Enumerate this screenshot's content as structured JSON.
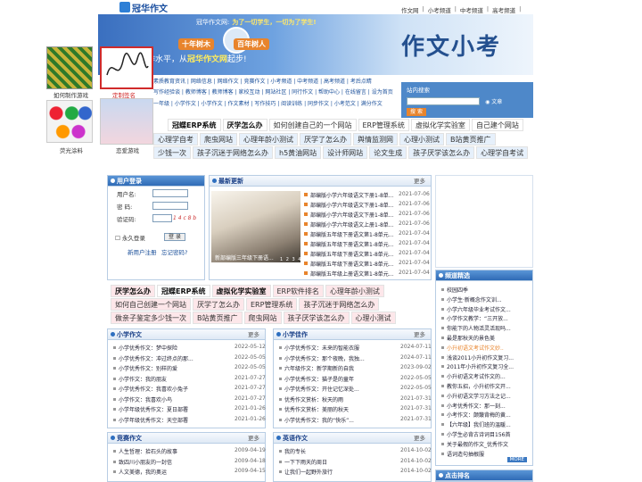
{
  "header": {
    "logo_text": "冠华作文",
    "top_links": [
      "作文网",
      "|",
      "小考频道",
      "|",
      "中考频道",
      "|",
      "高考频道",
      "|"
    ],
    "slogan_site": "冠华作文网:",
    "slogan": "为了一切学生，一切为了学生!",
    "tag1": "十年树木",
    "tag2": "百年树人",
    "sub_prefix": "作水平，从",
    "sub_brand": "冠华作文网",
    "sub_suffix": "起步!",
    "big_title": "作文小考"
  },
  "ads": [
    {
      "caption": "如何制作游戏"
    },
    {
      "caption": "定制签名"
    },
    {
      "caption": "荧光涂料"
    },
    {
      "caption": "恋爱游戏"
    }
  ],
  "nav_lines": [
    "素质教育资讯 | 网络信息 | 网络作文 | 竞赛作文 | 小考频道 | 中考频道 | 高考频道 | 考后点睛",
    "写作经验谈 | 教师博客 | 教师博客 | 家校互动 | 网站社区 | 同行作文 | 帮助中心 | 在线留言 | 设为首页",
    "一年级 | 小学作文 | 小学作文 | 作文素材 | 写作技巧 | 阅读训练 | 同步作文 | 小考范文 | 满分作文"
  ],
  "search": {
    "title": "站内搜索",
    "radio": "文章",
    "button": "搜 索"
  },
  "tag_rows": [
    [
      "冠蝶ERP系统",
      "厌学怎么办",
      "如何创建自己的一个网站",
      "ERP管理系统",
      "虚拟化学实验室",
      "自己建个网站"
    ],
    [
      "心理学自考",
      "爬虫网站",
      "心理年龄小测试",
      "厌学了怎么办",
      "舆情监测网",
      "心理小测试",
      "B站黄页推广"
    ],
    [
      "少钱一次",
      "孩子沉迷于网络怎么办",
      "h5黄油网站",
      "设计师网站",
      "论文生成",
      "孩子厌学该怎么办",
      "心理学自考试"
    ]
  ],
  "tag_rows2": [
    [
      "厌学怎么办",
      "冠蝶ERP系统",
      "虚拟化学实验室",
      "ERP软件排名",
      "心理年龄小测试"
    ],
    [
      "如何自己创建一个网站",
      "厌学了怎么办",
      "ERP管理系统",
      "孩子沉迷于网络怎么办"
    ],
    [
      "做亲子鉴定多少钱一次",
      "B站黄页推广",
      "爬虫网站",
      "孩子厌学该怎么办",
      "心理小测试"
    ]
  ],
  "login": {
    "title": "用户登录",
    "user_label": "用户名:",
    "pwd_label": "密 码:",
    "code_label": "验证码:",
    "captcha": "1 4 c 8 b",
    "remember": "永久登录",
    "login_btn": "登 录",
    "register": "新用户注册",
    "forgot": "忘记密码?"
  },
  "latest": {
    "title": "最新更新",
    "more": "更多",
    "img_caption": "新部编版三年级下册语...",
    "pager": "1 2 3 4 5",
    "items": [
      {
        "t": "部编版小学六年级语文下册1-8单...",
        "d": "2021-07-06"
      },
      {
        "t": "部编版小学六年级语文下册1-8单...",
        "d": "2021-07-06"
      },
      {
        "t": "部编版小学六年级语文下册1-8单...",
        "d": "2021-07-06"
      },
      {
        "t": "部编版小学六年级语文上册1-8单...",
        "d": "2021-07-06"
      },
      {
        "t": "部编版五年级下册语文第1-8单元...",
        "d": "2021-07-04"
      },
      {
        "t": "部编版五年级下册语文第1-8单元...",
        "d": "2021-07-04"
      },
      {
        "t": "部编版五年级下册语文第1-8单元...",
        "d": "2021-07-04"
      },
      {
        "t": "部编版五年级下册语文第1-8单元...",
        "d": "2021-07-04"
      },
      {
        "t": "部编版五年级上册语文第1-8单元...",
        "d": "2021-07-04"
      }
    ]
  },
  "pindao": {
    "title": "频道精选",
    "items": [
      "校园四季",
      "小学生·新概念作文训...",
      "小学六年级毕业考试作文...",
      "小学作文教学：“三开放...",
      "你能下的人物活灵活现吗...",
      "最是那秋天的景色美",
      "小升初语文考试作文妙..",
      "浅谈2011小升初作文复习...",
      "2011年小升初作文复习全...",
      "小升初语文考试作文的...",
      "教你五招，小升初作文开...",
      "小升初语文学习方法之记...",
      "小考优秀作文：那一刻...",
      "小考作文：颠簸背梅的黄...",
      "【六年级】我们班的温暖...",
      "小学生必背古诗词目156首",
      "关于最假的作文_优秀作文",
      "语词造句抽根服"
    ],
    "more": "MORE"
  },
  "dianji": {
    "title": "点击排名"
  },
  "xiaoxue": {
    "title": "小学作文",
    "more": "更多",
    "items": [
      {
        "t": "小学优秀作文：梦中探险",
        "d": "2022-05-12"
      },
      {
        "t": "小学优秀作文：冲过终点的那...",
        "d": "2022-05-05"
      },
      {
        "t": "小学优秀作文：别样的爱",
        "d": "2022-05-05"
      },
      {
        "t": "小学作文：我的朋友",
        "d": "2021-07-27"
      },
      {
        "t": "小学优秀作文：我喜欢小兔子",
        "d": "2021-07-27"
      },
      {
        "t": "小学作文：我喜欢小鸟",
        "d": "2021-07-27"
      },
      {
        "t": "小学年级优秀作文：夏日部署",
        "d": "2021-01-26"
      },
      {
        "t": "小学年级优秀作文：天空部署",
        "d": "2021-01-26"
      }
    ]
  },
  "xiaoxieyue": {
    "title": "小学佳作",
    "more": "更多",
    "items": [
      {
        "t": "小学优秀作文：未来的智能衣服",
        "d": "2024-07-11"
      },
      {
        "t": "小学优秀作文：那个夜晚，我独...",
        "d": "2024-07-11"
      },
      {
        "t": "六年级作文：新学期新的自我",
        "d": "2023-09-02"
      },
      {
        "t": "小学优秀作文：猫子是的童年",
        "d": "2022-05-05"
      },
      {
        "t": "小学优秀作文：开住记忆深处...",
        "d": "2022-05-05"
      },
      {
        "t": "优秀作文赏析：秋天的雨",
        "d": "2021-07-31"
      },
      {
        "t": "优秀作文赏析：美丽的秋天",
        "d": "2021-07-31"
      },
      {
        "t": "小学优秀作文：我的“快乐”...",
        "d": "2021-07-31"
      }
    ]
  },
  "jingsai": {
    "title": "竞赛作文",
    "more": "更多",
    "items": [
      {
        "t": "人生哲理：拾石头的故事",
        "d": "2009-04-19"
      },
      {
        "t": "致四川小朋友的一封信",
        "d": "2009-04-18"
      },
      {
        "t": "人文美德，我的奥运",
        "d": "2009-04-15"
      }
    ]
  },
  "yingyu": {
    "title": "英语作文",
    "more": "更多",
    "items": [
      {
        "t": "我的专长",
        "d": "2014-10-02"
      },
      {
        "t": "一下下雨天的周日",
        "d": "2014-10-02"
      },
      {
        "t": "让我们一起野外旅行",
        "d": "2014-10-02"
      }
    ]
  }
}
